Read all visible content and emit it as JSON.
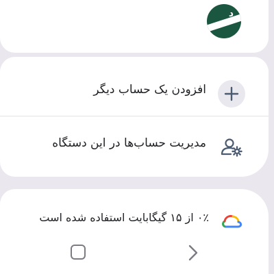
{
  "account": {
    "name": "",
    "email": "",
    "avatar_text": "د"
  },
  "actions": {
    "add_account_label": "افزودن یک حساب دیگر",
    "manage_accounts_label": "مدیریت حساب‌ها در این دستگاه"
  },
  "storage": {
    "label": "۰٪ از ۱۵ گیگابایت استفاده شده است",
    "used_gb": 0,
    "total_gb": 15
  },
  "bottom_partial_text": "",
  "icons": {
    "add": "plus-icon",
    "manage": "manage-accounts-icon",
    "storage": "google-cloud-icon",
    "nav_recents": "recents-square-icon",
    "nav_back": "back-chevron-icon"
  },
  "colors": {
    "background": "#ebe7ef",
    "card": "#ffffff",
    "avatar": "#1b5640",
    "icon": "#4a5a70"
  }
}
